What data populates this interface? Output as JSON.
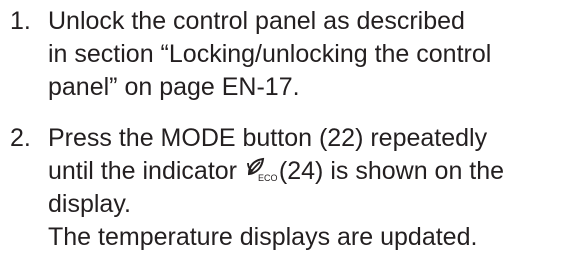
{
  "steps": [
    {
      "number": "1.",
      "lines": [
        "Unlock the control panel as described",
        "in section “Locking/unlocking the control",
        "panel” on page EN-17."
      ]
    },
    {
      "number": "2.",
      "line1": "Press the MODE button (22) repeatedly",
      "line2_before": "until the indicator",
      "icon": {
        "name": "eco-leaf-icon",
        "subscript": "ECO"
      },
      "line2_after": "(24) is shown on the",
      "line3": "display.",
      "result": "The temperature displays are updated."
    }
  ]
}
